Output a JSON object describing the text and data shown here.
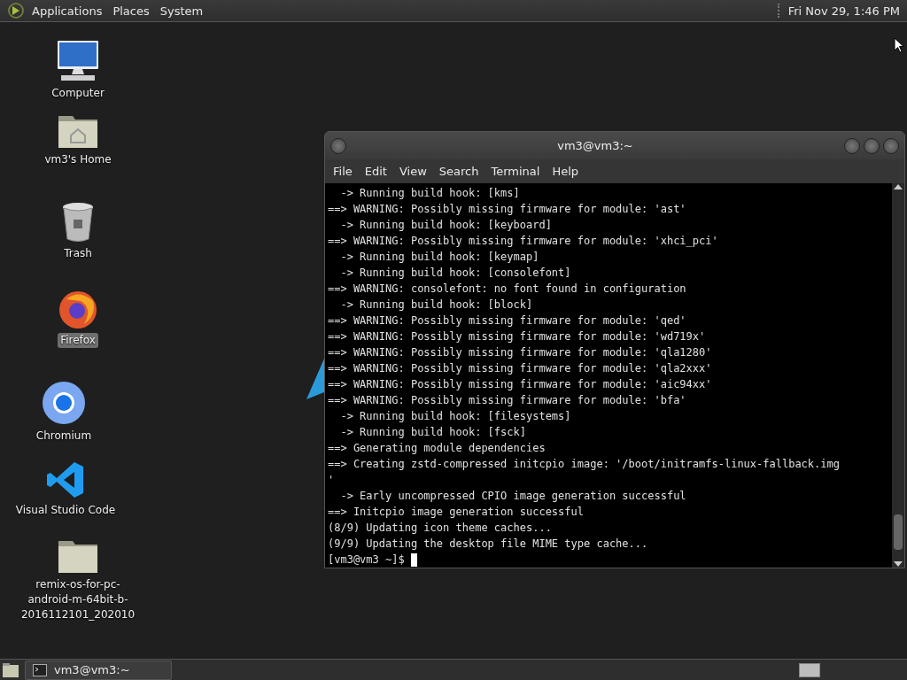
{
  "top_panel": {
    "menus": [
      "Applications",
      "Places",
      "System"
    ],
    "clock": "Fri Nov 29, 1:46 PM"
  },
  "desktop_icons": [
    {
      "kind": "computer",
      "label": "Computer",
      "selected": false
    },
    {
      "kind": "home",
      "label": "vm3's Home",
      "selected": false
    },
    {
      "kind": "trash",
      "label": "Trash",
      "selected": false
    },
    {
      "kind": "firefox",
      "label": "Firefox",
      "selected": true
    },
    {
      "kind": "chromium",
      "label": "Chromium",
      "selected": false
    },
    {
      "kind": "vscode",
      "label": "Visual Studio Code",
      "selected": false
    },
    {
      "kind": "folder",
      "label": "remix-os-for-pc-android-m-64bit-b-2016112101_202010",
      "selected": false
    }
  ],
  "terminal": {
    "title": "vm3@vm3:~",
    "menu": [
      "File",
      "Edit",
      "View",
      "Search",
      "Terminal",
      "Help"
    ],
    "lines": [
      "  -> Running build hook: [kms]",
      "==> WARNING: Possibly missing firmware for module: 'ast'",
      "  -> Running build hook: [keyboard]",
      "==> WARNING: Possibly missing firmware for module: 'xhci_pci'",
      "  -> Running build hook: [keymap]",
      "  -> Running build hook: [consolefont]",
      "==> WARNING: consolefont: no font found in configuration",
      "  -> Running build hook: [block]",
      "==> WARNING: Possibly missing firmware for module: 'qed'",
      "==> WARNING: Possibly missing firmware for module: 'wd719x'",
      "==> WARNING: Possibly missing firmware for module: 'qla1280'",
      "==> WARNING: Possibly missing firmware for module: 'qla2xxx'",
      "==> WARNING: Possibly missing firmware for module: 'aic94xx'",
      "==> WARNING: Possibly missing firmware for module: 'bfa'",
      "  -> Running build hook: [filesystems]",
      "  -> Running build hook: [fsck]",
      "==> Generating module dependencies",
      "==> Creating zstd-compressed initcpio image: '/boot/initramfs-linux-fallback.img",
      "'",
      "  -> Early uncompressed CPIO image generation successful",
      "==> Initcpio image generation successful",
      "(8/9) Updating icon theme caches...",
      "(9/9) Updating the desktop file MIME type cache..."
    ],
    "prompt": "[vm3@vm3 ~]$"
  },
  "taskbar": {
    "tasks": [
      {
        "label": "vm3@vm3:~",
        "selected": false
      }
    ]
  }
}
